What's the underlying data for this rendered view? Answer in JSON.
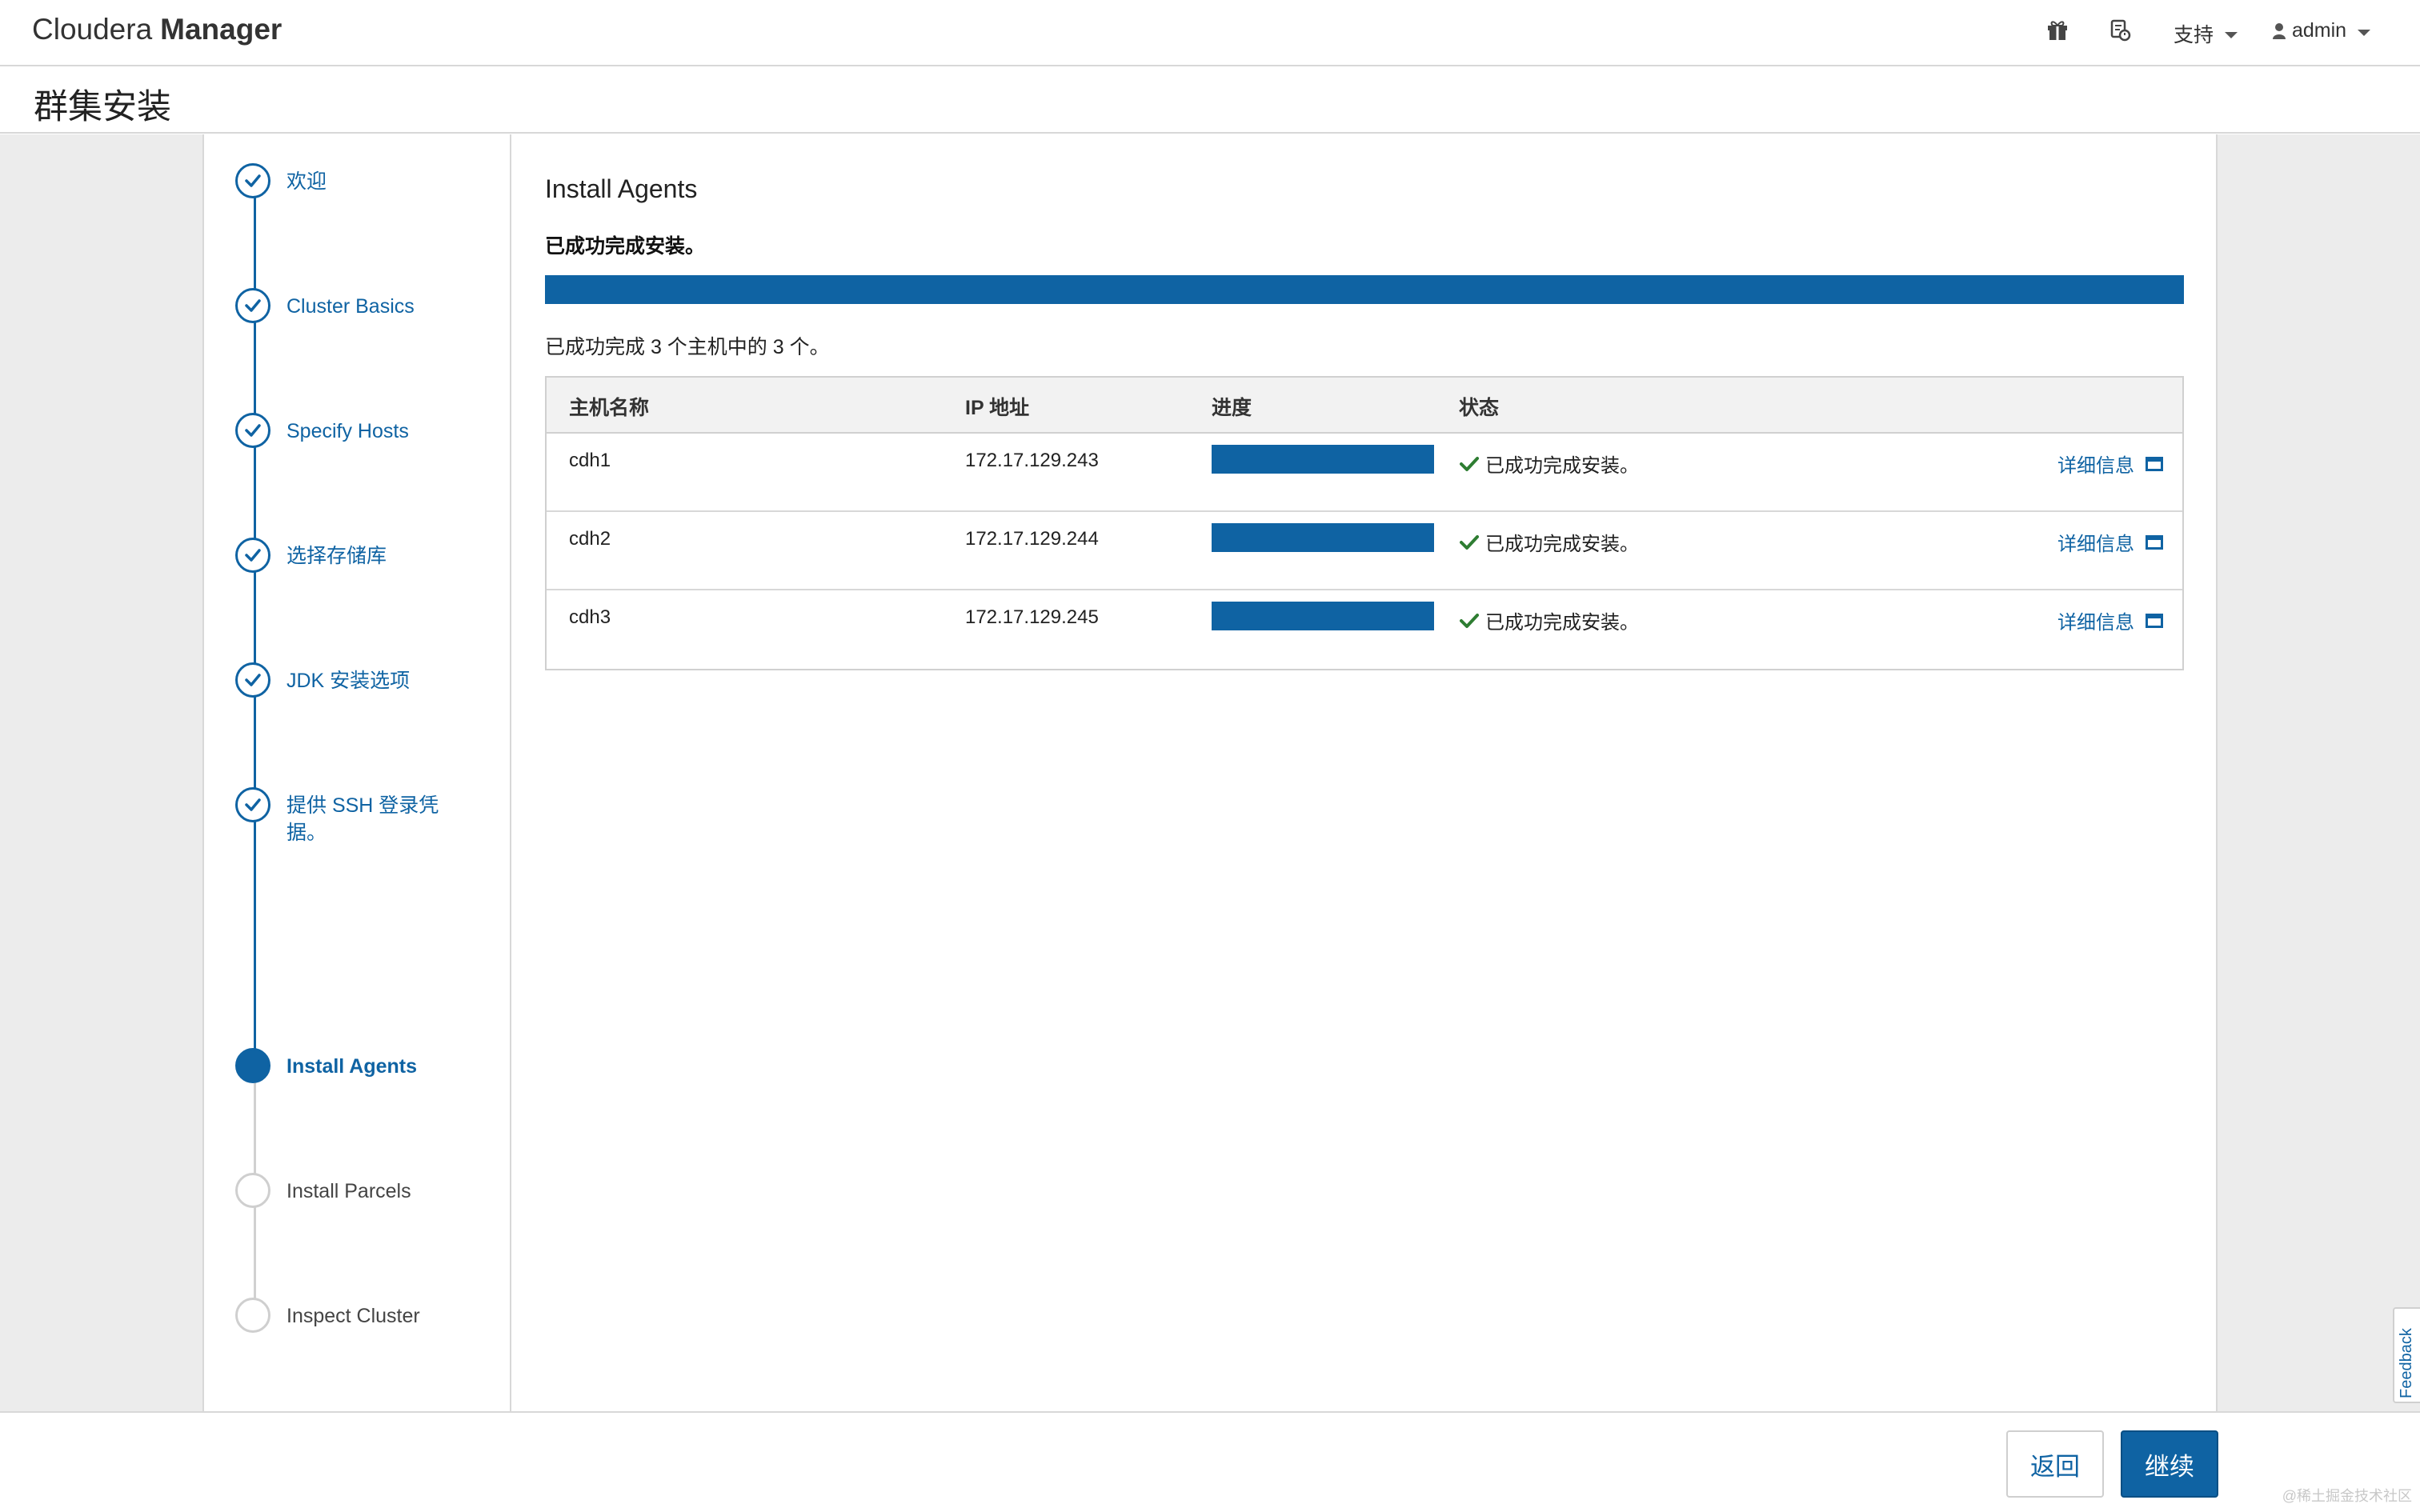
{
  "brand": {
    "name": "Cloudera",
    "product": "Manager"
  },
  "topnav": {
    "gift_icon": "gift-icon",
    "tasks_icon": "running-tasks-icon",
    "support_label": "支持",
    "user_icon": "user-icon",
    "user_label": "admin"
  },
  "page": {
    "title": "群集安装"
  },
  "steps": [
    {
      "label": "欢迎",
      "state": "done"
    },
    {
      "label": "Cluster Basics",
      "state": "done"
    },
    {
      "label": "Specify Hosts",
      "state": "done"
    },
    {
      "label": "选择存储库",
      "state": "done"
    },
    {
      "label": "JDK 安装选项",
      "state": "done"
    },
    {
      "label": "提供 SSH 登录凭据。",
      "state": "done"
    },
    {
      "label": "Install Agents",
      "state": "current"
    },
    {
      "label": "Install Parcels",
      "state": "todo"
    },
    {
      "label": "Inspect Cluster",
      "state": "todo"
    }
  ],
  "content": {
    "section_title": "Install Agents",
    "summary": "已成功完成安装。",
    "overall_progress": 1.0,
    "count_text": "已成功完成 3 个主机中的 3 个。"
  },
  "table": {
    "headers": {
      "host": "主机名称",
      "ip": "IP 地址",
      "progress": "进度",
      "status": "状态"
    },
    "rows": [
      {
        "host": "cdh1",
        "ip": "172.17.129.243",
        "progress": 1.0,
        "status": "已成功完成安装。",
        "details": "详细信息"
      },
      {
        "host": "cdh2",
        "ip": "172.17.129.244",
        "progress": 1.0,
        "status": "已成功完成安装。",
        "details": "详细信息"
      },
      {
        "host": "cdh3",
        "ip": "172.17.129.245",
        "progress": 1.0,
        "status": "已成功完成安装。",
        "details": "详细信息"
      }
    ]
  },
  "footer": {
    "back_label": "返回",
    "continue_label": "继续"
  },
  "feedback_label": "Feedback",
  "watermark": "@稀土掘金技术社区",
  "colors": {
    "accent": "#0f63a3",
    "success": "#2e7d32",
    "border": "#d8d8d8",
    "background": "#ececec"
  }
}
